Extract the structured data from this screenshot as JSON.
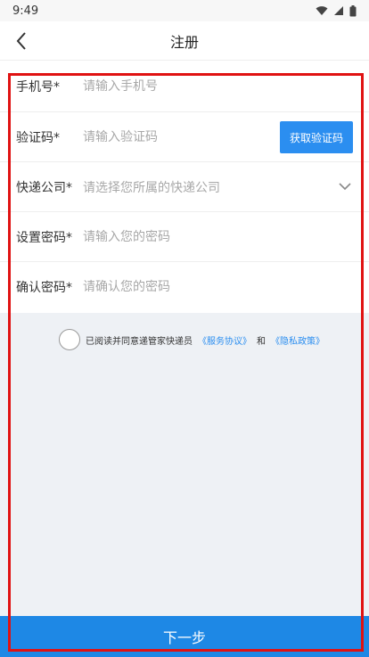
{
  "status_bar": {
    "time": "9:49"
  },
  "nav": {
    "title": "注册"
  },
  "form": {
    "phone": {
      "label": "手机号*",
      "placeholder": "请输入手机号"
    },
    "code": {
      "label": "验证码*",
      "placeholder": "请输入验证码",
      "button": "获取验证码"
    },
    "courier": {
      "label": "快递公司*",
      "placeholder": "请选择您所属的快递公司"
    },
    "password": {
      "label": "设置密码*",
      "placeholder": "请输入您的密码"
    },
    "confirm": {
      "label": "确认密码*",
      "placeholder": "请确认您的密码"
    }
  },
  "agreement": {
    "prefix": "已阅读并同意递管家快递员",
    "service_link": "《服务协议》",
    "and": "和",
    "privacy_link": "《隐私政策》"
  },
  "footer": {
    "next_button": "下一步"
  },
  "colors": {
    "accent": "#1e88e5",
    "highlight": "#e01212"
  }
}
